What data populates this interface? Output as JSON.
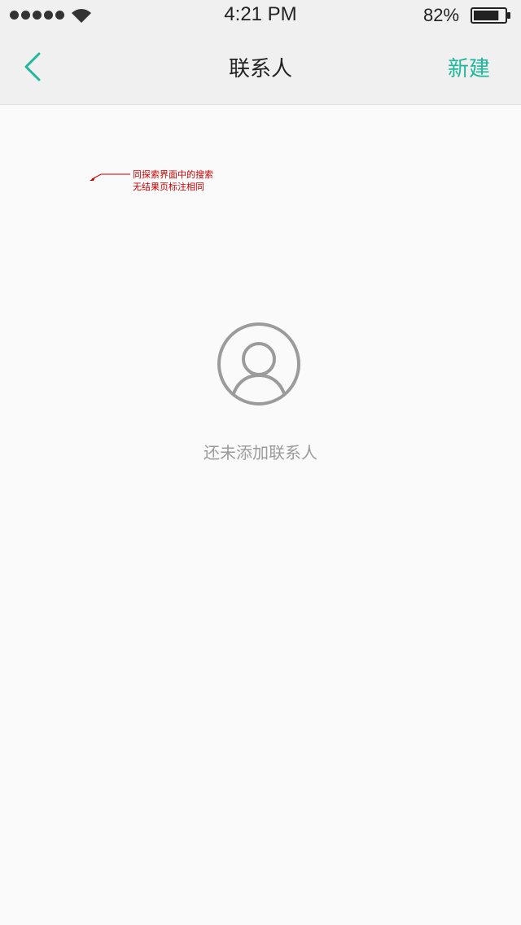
{
  "status_bar": {
    "time": "4:21 PM",
    "battery_percent": "82%",
    "battery_level": 0.82,
    "signal_bars": 5,
    "icons": [
      "signal-dots-icon",
      "wifi-icon",
      "battery-icon"
    ]
  },
  "nav": {
    "back_icon": "chevron-left-icon",
    "title": "联系人",
    "new_label": "新建"
  },
  "annotation": {
    "text": "同探索界面中的搜索无结果页标注相同"
  },
  "empty_state": {
    "icon": "user-circle-icon",
    "message": "还未添加联系人"
  },
  "colors": {
    "accent": "#1fb89d",
    "empty_gray": "#9b9b9b",
    "annotation_red": "#cc0000",
    "bar_background": "#f0f0f0",
    "page_background": "#fafafa"
  }
}
